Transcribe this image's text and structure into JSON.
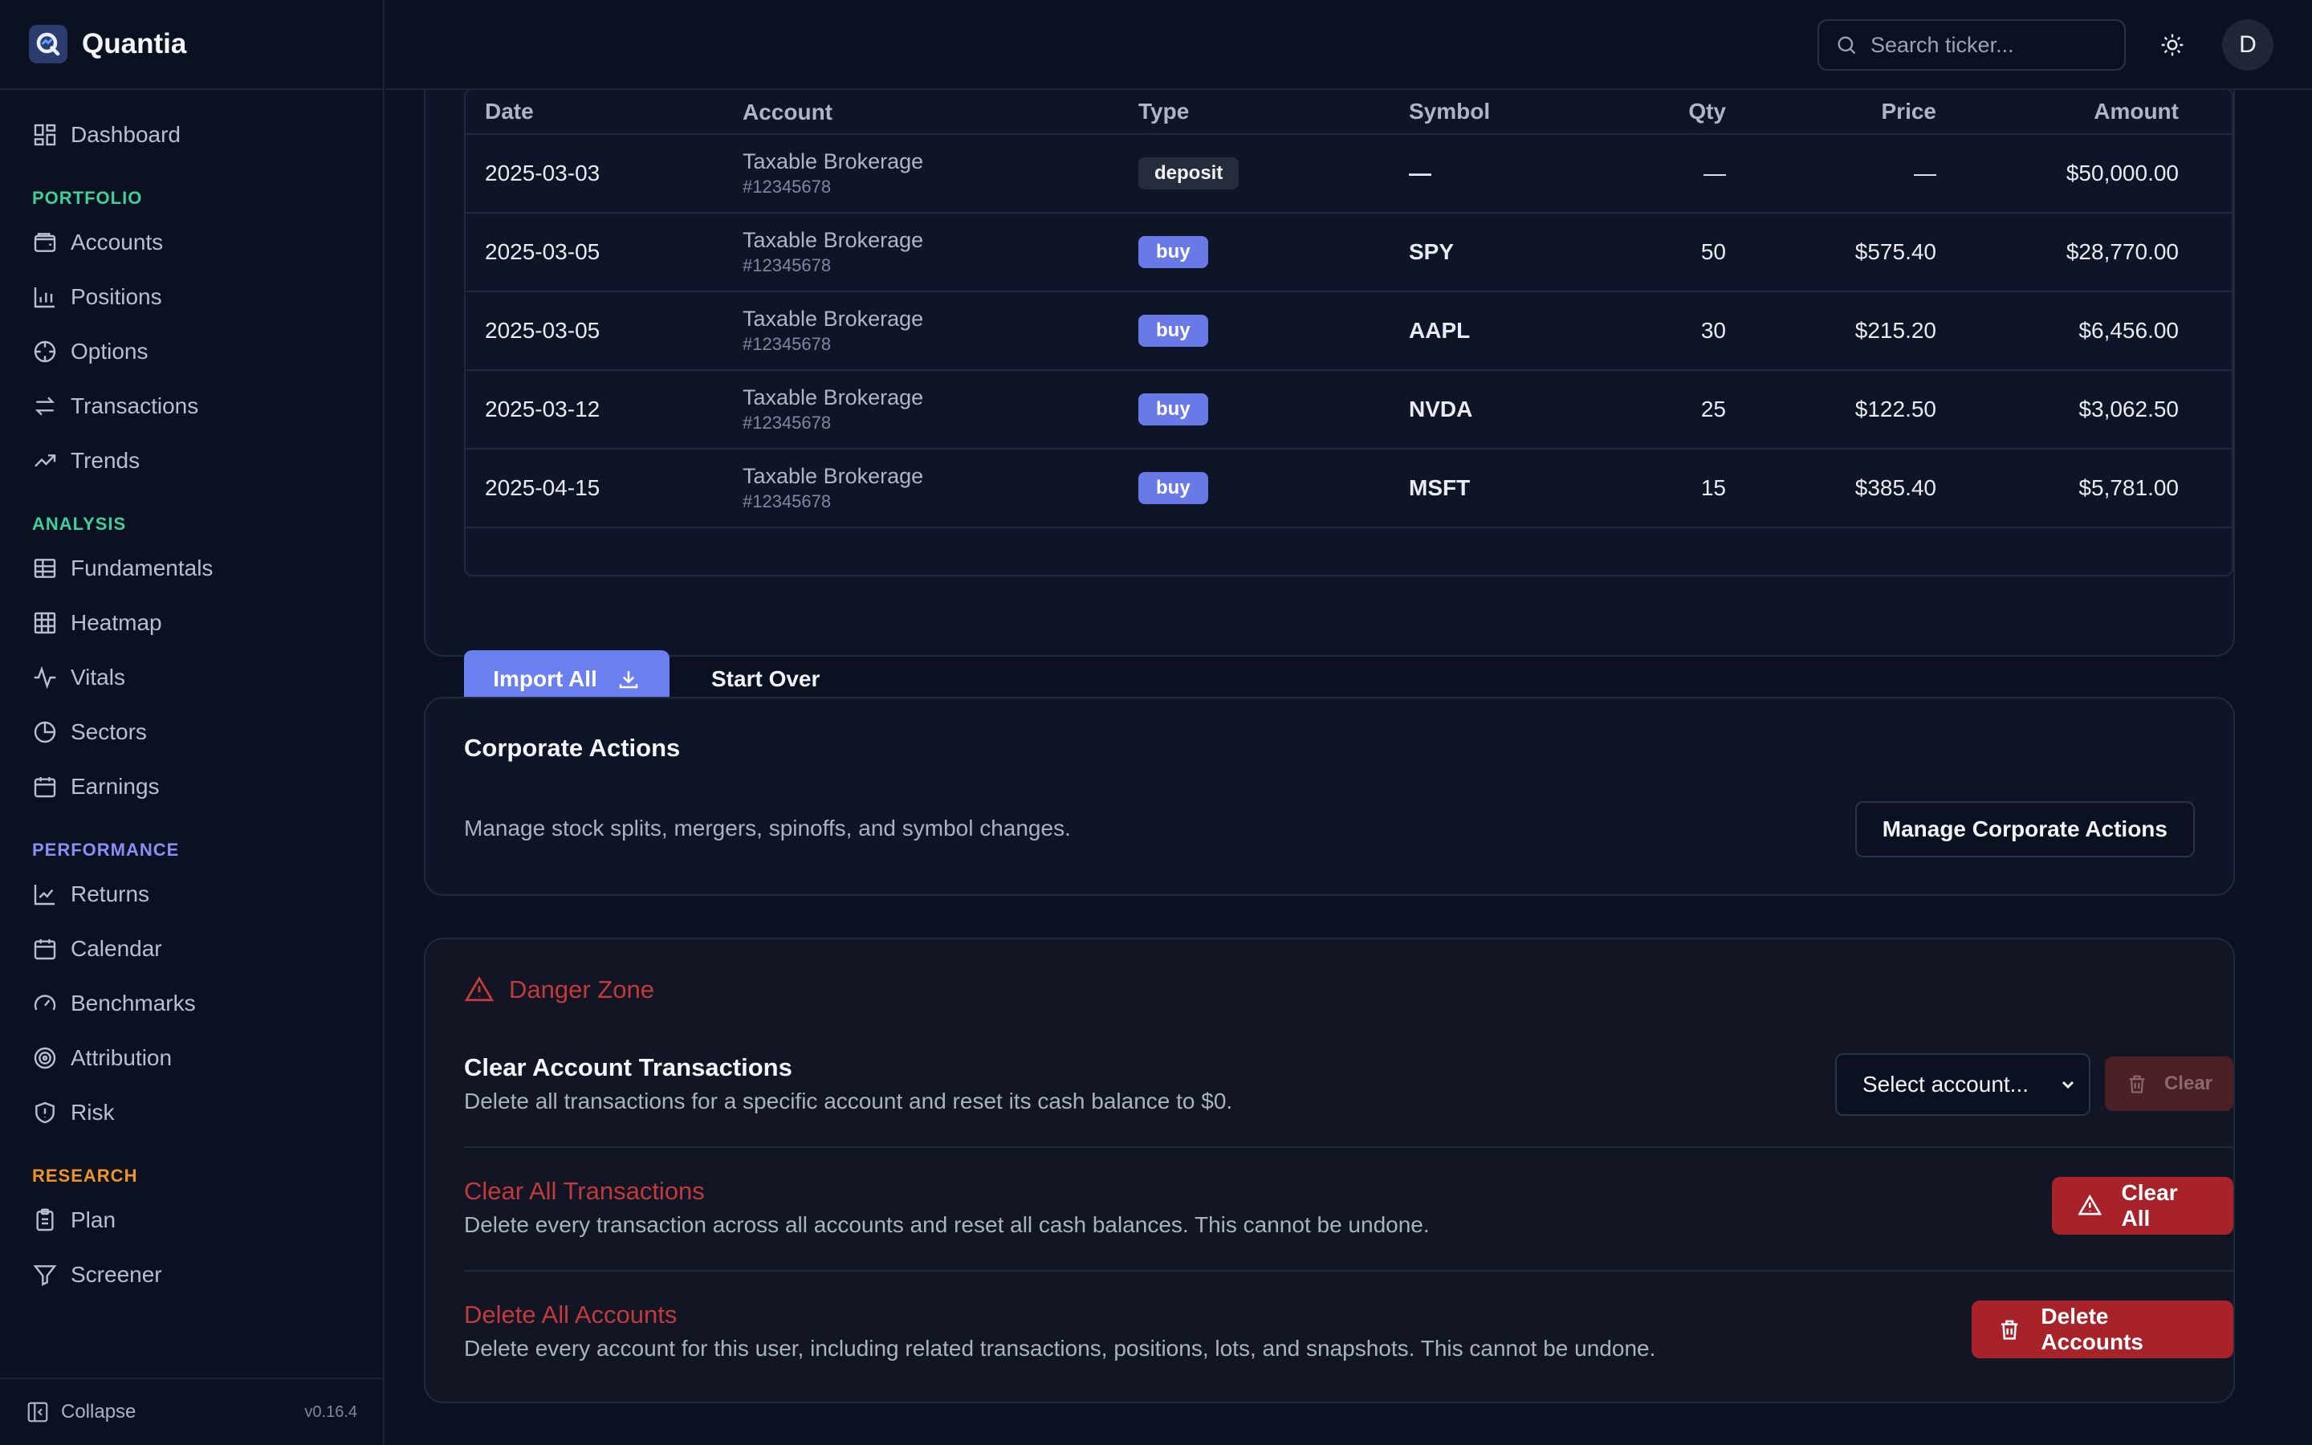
{
  "app": {
    "name": "Quantia",
    "version": "v0.16.4"
  },
  "sidebar": {
    "top_item": {
      "label": "Dashboard",
      "icon": "dashboard-icon"
    },
    "sections": [
      {
        "title": "PORTFOLIO",
        "color": "#3ecf9a",
        "items": [
          {
            "label": "Accounts",
            "icon": "wallet-icon"
          },
          {
            "label": "Positions",
            "icon": "bar-chart-icon"
          },
          {
            "label": "Options",
            "icon": "crosshair-icon"
          },
          {
            "label": "Transactions",
            "icon": "swap-icon"
          },
          {
            "label": "Trends",
            "icon": "trending-up-icon"
          }
        ]
      },
      {
        "title": "ANALYSIS",
        "color": "#3ecf9a",
        "items": [
          {
            "label": "Fundamentals",
            "icon": "table-icon"
          },
          {
            "label": "Heatmap",
            "icon": "grid-icon"
          },
          {
            "label": "Vitals",
            "icon": "activity-icon"
          },
          {
            "label": "Sectors",
            "icon": "pie-chart-icon"
          },
          {
            "label": "Earnings",
            "icon": "calendar-icon"
          }
        ]
      },
      {
        "title": "PERFORMANCE",
        "color": "#8a8ff7",
        "items": [
          {
            "label": "Returns",
            "icon": "line-chart-icon"
          },
          {
            "label": "Calendar",
            "icon": "calendar-icon"
          },
          {
            "label": "Benchmarks",
            "icon": "gauge-icon"
          },
          {
            "label": "Attribution",
            "icon": "target-icon"
          },
          {
            "label": "Risk",
            "icon": "shield-icon"
          }
        ]
      },
      {
        "title": "RESEARCH",
        "color": "#f0932b",
        "items": [
          {
            "label": "Plan",
            "icon": "clipboard-icon"
          },
          {
            "label": "Screener",
            "icon": "filter-icon"
          }
        ]
      }
    ],
    "footer": {
      "collapse_label": "Collapse"
    }
  },
  "topbar": {
    "search_placeholder": "Search ticker...",
    "avatar_initial": "D"
  },
  "import": {
    "columns": [
      "Date",
      "Account",
      "Type",
      "Symbol",
      "Qty",
      "Price",
      "Amount"
    ],
    "rows": [
      {
        "date": "2025-03-03",
        "account": "Taxable Brokerage",
        "account_num": "#12345678",
        "type": "deposit",
        "symbol": "—",
        "qty": "—",
        "price": "—",
        "amount": "$50,000.00"
      },
      {
        "date": "2025-03-05",
        "account": "Taxable Brokerage",
        "account_num": "#12345678",
        "type": "buy",
        "symbol": "SPY",
        "qty": "50",
        "price": "$575.40",
        "amount": "$28,770.00"
      },
      {
        "date": "2025-03-05",
        "account": "Taxable Brokerage",
        "account_num": "#12345678",
        "type": "buy",
        "symbol": "AAPL",
        "qty": "30",
        "price": "$215.20",
        "amount": "$6,456.00"
      },
      {
        "date": "2025-03-12",
        "account": "Taxable Brokerage",
        "account_num": "#12345678",
        "type": "buy",
        "symbol": "NVDA",
        "qty": "25",
        "price": "$122.50",
        "amount": "$3,062.50"
      },
      {
        "date": "2025-04-15",
        "account": "Taxable Brokerage",
        "account_num": "#12345678",
        "type": "buy",
        "symbol": "MSFT",
        "qty": "15",
        "price": "$385.40",
        "amount": "$5,781.00"
      }
    ],
    "import_all_label": "Import All",
    "start_over_label": "Start Over"
  },
  "corporate_actions": {
    "title": "Corporate Actions",
    "description": "Manage stock splits, mergers, spinoffs, and symbol changes.",
    "button_label": "Manage Corporate Actions"
  },
  "danger_zone": {
    "title": "Danger Zone",
    "clear_account": {
      "title": "Clear Account Transactions",
      "description": "Delete all transactions for a specific account and reset its cash balance to $0.",
      "select_value": "Select account...",
      "button_label": "Clear"
    },
    "clear_all": {
      "title": "Clear All Transactions",
      "description": "Delete every transaction across all accounts and reset all cash balances. This cannot be undone.",
      "button_label": "Clear All"
    },
    "delete_accounts": {
      "title": "Delete All Accounts",
      "description": "Delete every account for this user, including related transactions, positions, lots, and snapshots. This cannot be undone.",
      "button_label": "Delete Accounts"
    }
  }
}
